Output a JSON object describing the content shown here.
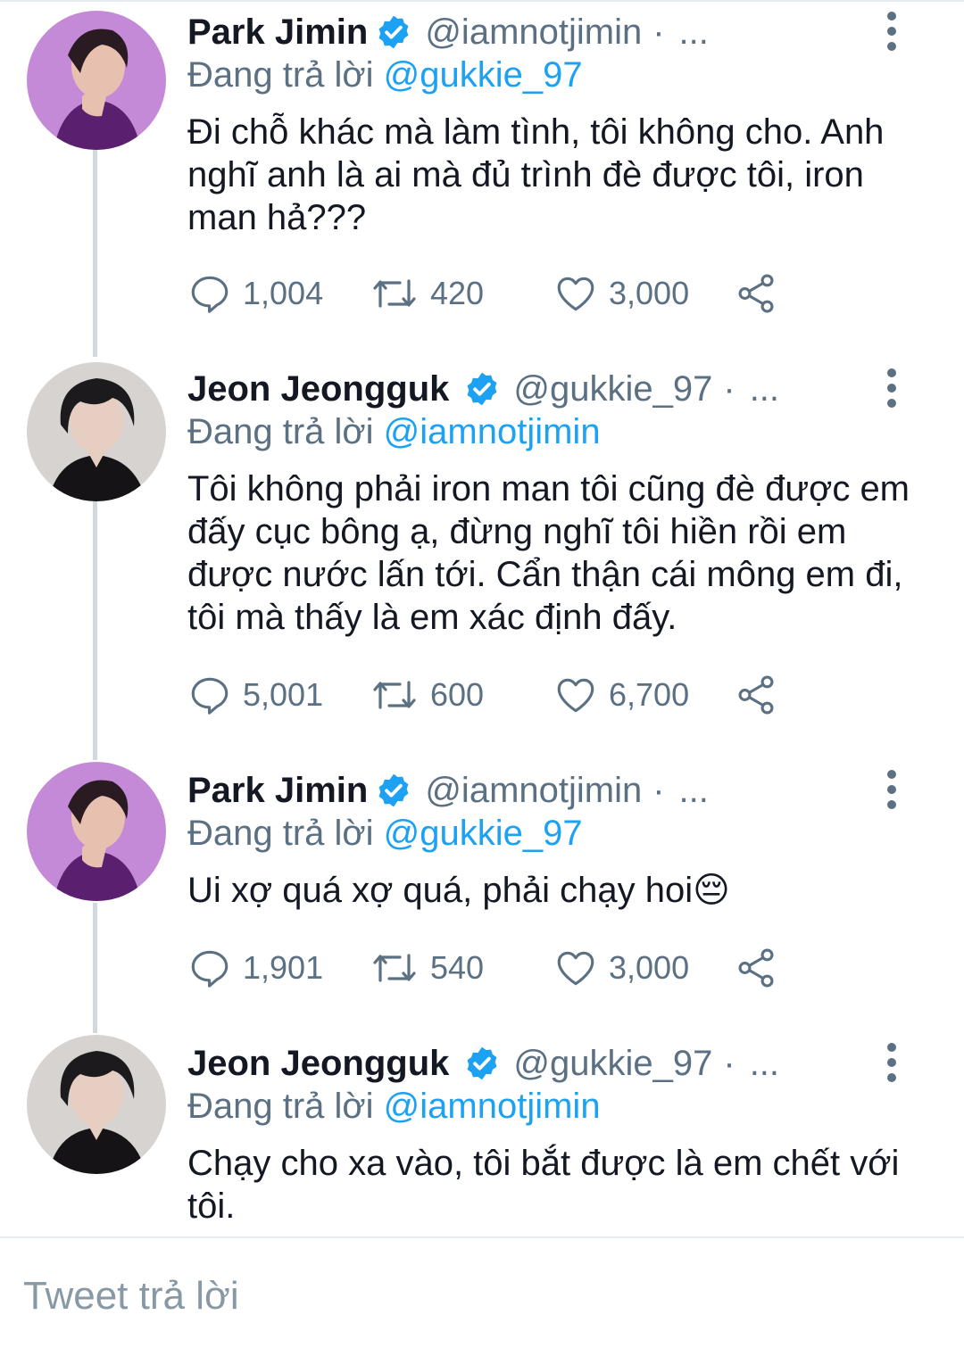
{
  "thread": {
    "tweets": [
      {
        "display_name": "Park Jimin",
        "handle": "@iamnotjimin",
        "dot": "·",
        "ellipsis": "...",
        "replying_prefix": "Đang trả lời",
        "replying_to": "@gukkie_97",
        "text": "Đi chỗ khác mà làm tình, tôi không cho. Anh nghĩ anh là ai mà đủ trình đè được tôi, iron man hả???",
        "replies": "1,004",
        "retweets": "420",
        "likes": "3,000",
        "avatar": "purple-background-portrait"
      },
      {
        "display_name": "Jeon Jeongguk",
        "handle": "@gukkie_97",
        "dot": "·",
        "ellipsis": "...",
        "replying_prefix": "Đang trả lời",
        "replying_to": "@iamnotjimin",
        "text": "Tôi không phải iron man tôi cũng đè được em đấy cục bông ạ, đừng nghĩ tôi hiền rồi em được nước lấn tới. Cẩn thận cái mông em đi, tôi mà thấy là em xác định đấy.",
        "replies": "5,001",
        "retweets": "600",
        "likes": "6,700",
        "avatar": "grey-background-portrait"
      },
      {
        "display_name": "Park Jimin",
        "handle": "@iamnotjimin",
        "dot": "·",
        "ellipsis": "...",
        "replying_prefix": "Đang trả lời",
        "replying_to": "@gukkie_97",
        "text": "Ui xợ quá xợ quá, phải chạy hoi😔",
        "replies": "1,901",
        "retweets": "540",
        "likes": "3,000",
        "avatar": "purple-background-portrait"
      },
      {
        "display_name": "Jeon Jeongguk",
        "handle": "@gukkie_97",
        "dot": "·",
        "ellipsis": "...",
        "replying_prefix": "Đang trả lời",
        "replying_to": "@iamnotjimin",
        "text": "Chạy cho xa vào, tôi bắt được là em chết với tôi.",
        "avatar": "grey-background-portrait"
      }
    ]
  },
  "compose": {
    "placeholder": "Tweet trả lời"
  },
  "icons": {
    "verified": "verified-badge-icon",
    "reply": "reply-bubble-icon",
    "retweet": "retweet-icon",
    "like": "heart-icon",
    "share": "share-icon",
    "more": "vertical-dots-icon"
  },
  "colors": {
    "accent": "#1da1f2",
    "secondary_text": "#5b7083",
    "primary_text": "#141823",
    "thread_line": "#cfd9de"
  }
}
